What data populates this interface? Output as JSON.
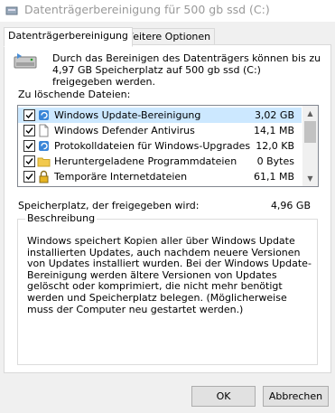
{
  "window": {
    "title": "Datenträgerbereinigung für 500 gb ssd (C:)"
  },
  "tabs": [
    {
      "label": "Datenträgerbereinigung",
      "active": true
    },
    {
      "label": "Weitere Optionen",
      "active": false
    }
  ],
  "intro_text": "Durch das Bereinigen des Datenträgers können bis zu 4,97 GB Speicherplatz auf 500 gb ssd (C:) freigegeben werden.",
  "files_label": "Zu löschende Dateien:",
  "files": [
    {
      "name": "Windows Update-Bereinigung",
      "size": "3,02 GB",
      "checked": true,
      "selected": true,
      "icon": "recycle-icon"
    },
    {
      "name": "Windows Defender Antivirus",
      "size": "14,1 MB",
      "checked": true,
      "selected": false,
      "icon": "file-icon"
    },
    {
      "name": "Protokolldateien für Windows-Upgrades",
      "size": "12,0 KB",
      "checked": true,
      "selected": false,
      "icon": "recycle-icon"
    },
    {
      "name": "Heruntergeladene Programmdateien",
      "size": "0 Bytes",
      "checked": true,
      "selected": false,
      "icon": "folder-icon"
    },
    {
      "name": "Temporäre Internetdateien",
      "size": "61,1 MB",
      "checked": true,
      "selected": false,
      "icon": "lock-icon"
    }
  ],
  "freed_label": "Speicherplatz, der freigegeben wird:",
  "freed_value": "4,96 GB",
  "description": {
    "legend": "Beschreibung",
    "text": "Windows speichert Kopien aller über Windows Update installierten Updates, auch nachdem neuere Versionen von Updates installiert wurden. Bei der Windows Update-Bereinigung werden ältere Versionen von Updates gelöscht oder komprimiert, die nicht mehr benötigt werden und Speicherplatz belegen. (Möglicherweise muss der Computer neu gestartet werden.)"
  },
  "buttons": {
    "ok": "OK",
    "cancel": "Abbrechen"
  },
  "colors": {
    "selection": "#cce8ff",
    "window_bg": "#f0f0f0"
  }
}
